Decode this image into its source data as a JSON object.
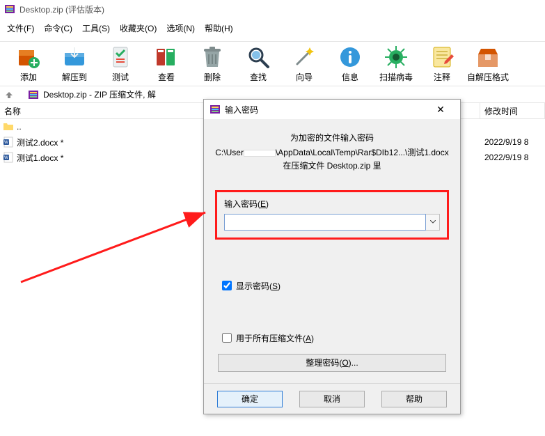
{
  "window": {
    "title": "Desktop.zip (评估版本)"
  },
  "menu": {
    "file": "文件(F)",
    "cmd": "命令(C)",
    "tool": "工具(S)",
    "fav": "收藏夹(O)",
    "opt": "选项(N)",
    "help": "帮助(H)"
  },
  "toolbar": {
    "add": "添加",
    "extract": "解压到",
    "test": "测试",
    "view": "查看",
    "delete": "删除",
    "find": "查找",
    "wizard": "向导",
    "info": "信息",
    "scan": "扫描病毒",
    "comment": "注释",
    "sfx": "自解压格式"
  },
  "address": {
    "text": "Desktop.zip - ZIP 压缩文件, 解"
  },
  "columns": {
    "name": "名称",
    "mtime": "修改时间"
  },
  "files": {
    "up": "..",
    "rows": [
      {
        "name": "测试2.docx *",
        "mtime": "2022/9/19 8"
      },
      {
        "name": "测试1.docx *",
        "mtime": "2022/9/19 8"
      }
    ]
  },
  "dialog": {
    "title": "输入密码",
    "msg_line1": "为加密的文件输入密码",
    "msg_path_pre": "C:\\User",
    "msg_path_post": "\\AppData\\Local\\Temp\\Rar$DIb12...\\测试1.docx",
    "msg_line3": "在压缩文件 Desktop.zip 里",
    "field_label_pre": "输入密码(",
    "field_label_key": "E",
    "field_label_post": ")",
    "input_value": "",
    "show_pw_pre": "显示密码(",
    "show_pw_key": "S",
    "show_pw_post": ")",
    "all_arc_pre": "用于所有压缩文件(",
    "all_arc_key": "A",
    "all_arc_post": ")",
    "organize_pre": "整理密码(",
    "organize_key": "O",
    "organize_post": ")...",
    "ok": "确定",
    "cancel": "取消",
    "help": "帮助",
    "close": "✕"
  }
}
